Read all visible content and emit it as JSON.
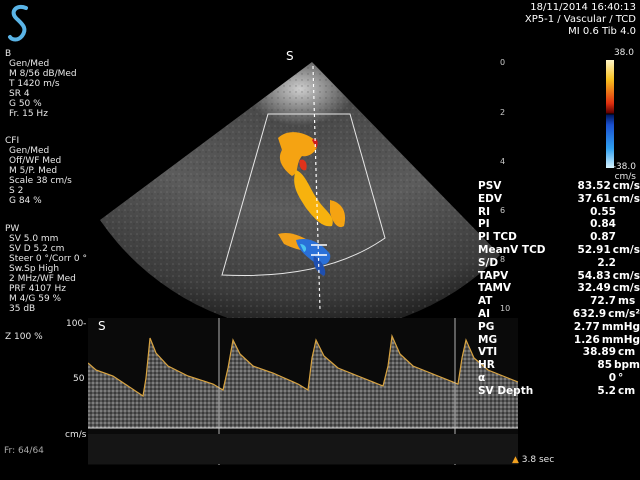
{
  "header": {
    "datetime": "18/11/2014 16:40:13",
    "probe_preset": "XP5-1 / Vascular / TCD",
    "mi_tib": "MI 0.6  Tib  4.0"
  },
  "left_panel": {
    "b_mode": {
      "title": "B",
      "lines": [
        "Gen/Med",
        "M 8/56 dB/Med",
        "T 1420 m/s",
        "SR 4",
        "G 50 %",
        "Fr. 15 Hz"
      ]
    },
    "cfi": {
      "title": "CFI",
      "lines": [
        "Gen/Med",
        "Off/WF Med",
        "M 5/P. Med",
        "Scale 38 cm/s",
        "S 2",
        "G 84 %"
      ]
    },
    "pw": {
      "title": "PW",
      "lines": [
        "SV 5.0 mm",
        "SV D 5.2 cm",
        "Steer 0 °/Corr 0 °",
        "Sw.Sp High",
        "2 MHz/WF Med",
        "PRF 4107 Hz",
        "M 4/G 59 %",
        "35 dB"
      ]
    },
    "zoom": "Z 100 %",
    "frame": "Fr: 64/64"
  },
  "depth_scale": [
    "0",
    "2",
    "4",
    "6",
    "8",
    "10"
  ],
  "color_bar": {
    "top": "38.0",
    "bottom": "-38.0",
    "unit": "cm/s"
  },
  "doppler": {
    "scale_100": "100-",
    "scale_50": "50",
    "unit": "cm/s",
    "sweep_time": "3.8 sec"
  },
  "measurements": [
    {
      "label": "PSV",
      "value": "83.52",
      "unit": "cm/s"
    },
    {
      "label": "EDV",
      "value": "37.61",
      "unit": "cm/s"
    },
    {
      "label": "RI",
      "value": "0.55",
      "unit": ""
    },
    {
      "label": "PI",
      "value": "0.84",
      "unit": ""
    },
    {
      "label": "PI TCD",
      "value": "0.87",
      "unit": ""
    },
    {
      "label": "MeanV TCD",
      "value": "52.91",
      "unit": "cm/s"
    },
    {
      "label": "S/D",
      "value": "2.2",
      "unit": ""
    },
    {
      "label": "TAPV",
      "value": "54.83",
      "unit": "cm/s"
    },
    {
      "label": "TAMV",
      "value": "32.49",
      "unit": "cm/s"
    },
    {
      "label": "AT",
      "value": "72.7",
      "unit": "ms"
    },
    {
      "label": "AI",
      "value": "632.9",
      "unit": "cm/s²"
    },
    {
      "label": "PG",
      "value": "2.77",
      "unit": "mmHg"
    },
    {
      "label": "MG",
      "value": "1.26",
      "unit": "mmHg"
    },
    {
      "label": "VTI",
      "value": "38.89",
      "unit": "cm"
    },
    {
      "label": "HR",
      "value": "85",
      "unit": "bpm"
    },
    {
      "label": "α",
      "value": "0",
      "unit": "°"
    },
    {
      "label": "SV Depth",
      "value": "5.2",
      "unit": "cm"
    }
  ],
  "colors": {
    "background": "#000000",
    "text": "#e8e8e8",
    "logo": "#5ab4e6",
    "trace": "#d9a441"
  }
}
